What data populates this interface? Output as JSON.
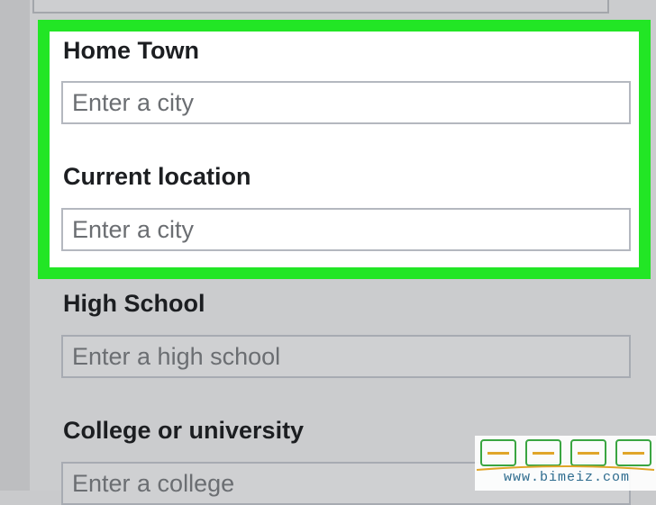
{
  "profile_form": {
    "sections": [
      {
        "label": "Home Town",
        "placeholder": "Enter a city"
      },
      {
        "label": "Current location",
        "placeholder": "Enter a city"
      },
      {
        "label": "High School",
        "placeholder": "Enter a high school"
      },
      {
        "label": "College or university",
        "placeholder": "Enter a college"
      }
    ],
    "highlight_color": "#22e625"
  },
  "watermark": {
    "url": "www.bimeiz.com"
  }
}
